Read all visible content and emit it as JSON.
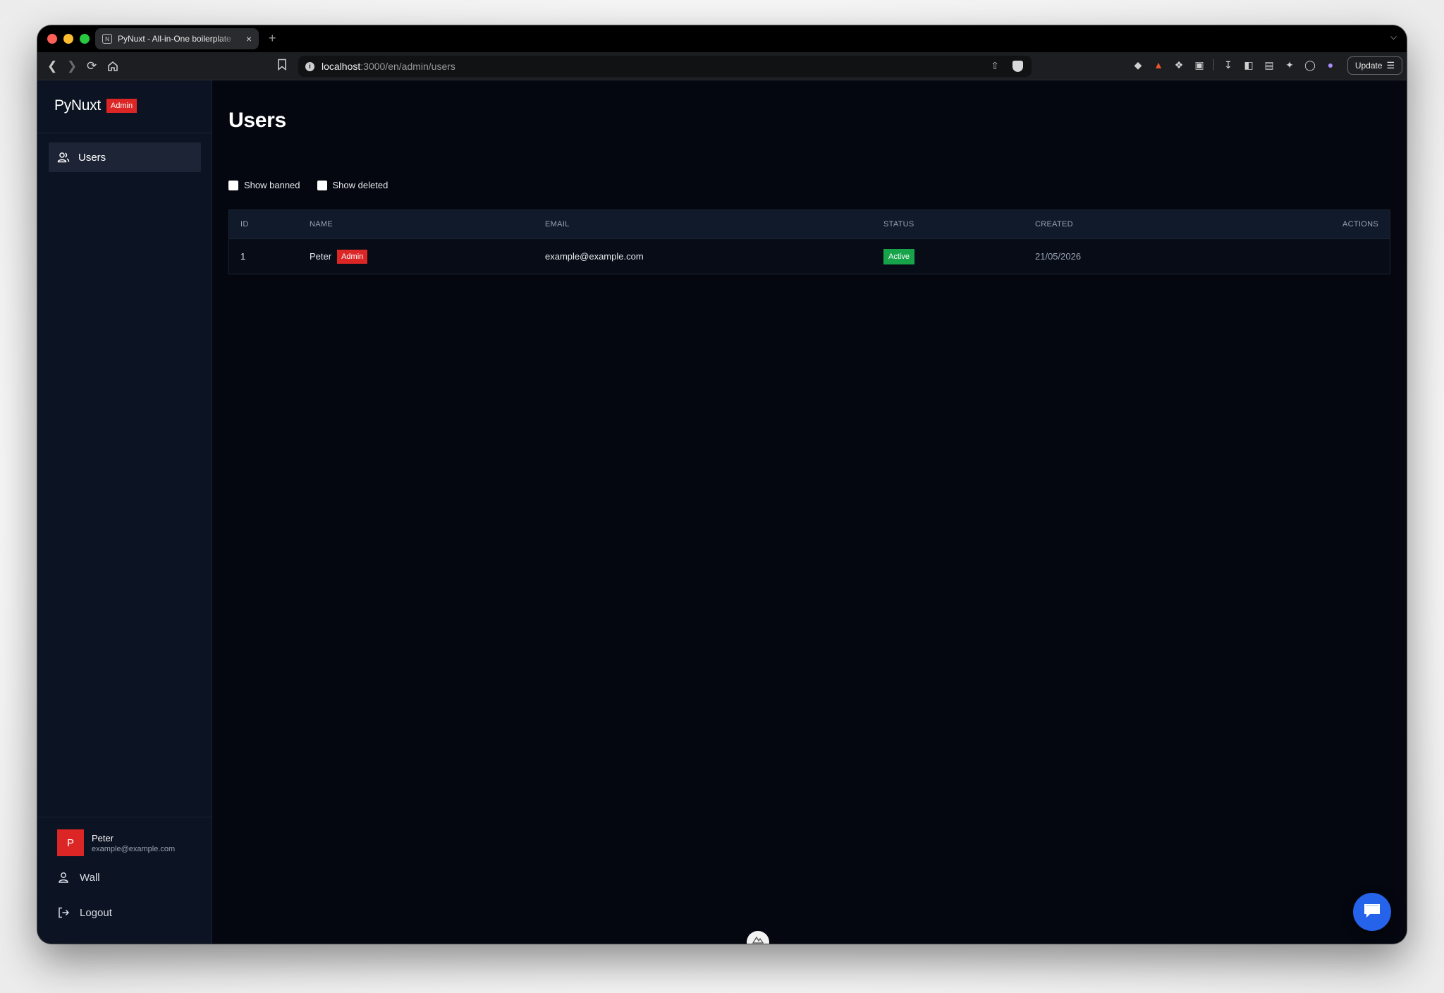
{
  "browser": {
    "tab_title": "PyNuxt - All-in-One boilerplate",
    "tab_close": "×",
    "new_tab": "+",
    "url_host": "localhost",
    "url_path": ":3000/en/admin/users",
    "update_label": "Update"
  },
  "brand": {
    "name": "PyNuxt",
    "badge": "Admin"
  },
  "sidebar": {
    "nav": [
      {
        "label": "Users",
        "icon": "users-icon",
        "active": true
      }
    ],
    "profile": {
      "initial": "P",
      "name": "Peter",
      "email": "example@example.com"
    },
    "links": {
      "wall": "Wall",
      "logout": "Logout"
    }
  },
  "page": {
    "title": "Users",
    "filters": {
      "banned": "Show banned",
      "deleted": "Show deleted"
    }
  },
  "table": {
    "columns": [
      "ID",
      "NAME",
      "EMAIL",
      "STATUS",
      "CREATED",
      "ACTIONS"
    ],
    "rows": [
      {
        "id": "1",
        "name": "Peter",
        "role_badge": "Admin",
        "email": "example@example.com",
        "status": "Active",
        "created": "21/05/2026"
      }
    ]
  },
  "colors": {
    "accent_red": "#dc2626",
    "status_green": "#16a34a",
    "chat_blue": "#2563eb",
    "sidebar_bg": "#0c1322",
    "main_bg": "#04070f"
  }
}
